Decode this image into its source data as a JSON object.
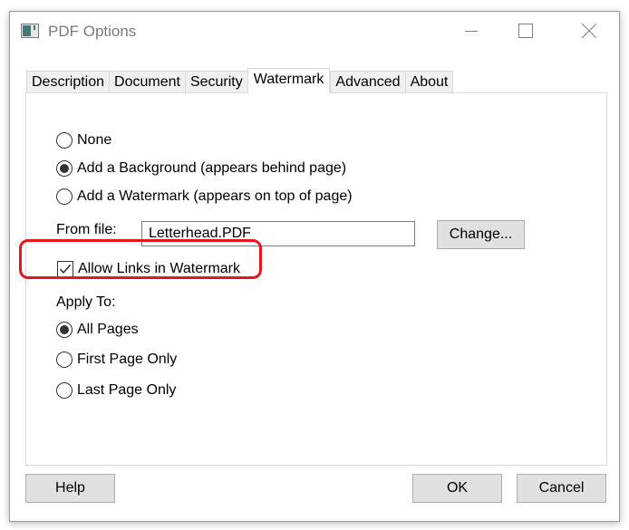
{
  "window": {
    "title": "PDF Options",
    "controls": {
      "minimize": "minimize",
      "maximize": "maximize",
      "close": "close"
    }
  },
  "tabs": [
    {
      "label": "Description",
      "active": false
    },
    {
      "label": "Document",
      "active": false
    },
    {
      "label": "Security",
      "active": false
    },
    {
      "label": "Watermark",
      "active": true
    },
    {
      "label": "Advanced",
      "active": false
    },
    {
      "label": "About",
      "active": false
    }
  ],
  "watermark": {
    "mode_options": [
      {
        "label": "None",
        "selected": false
      },
      {
        "label": "Add a Background (appears behind page)",
        "selected": true
      },
      {
        "label": "Add a Watermark (appears on top of page)",
        "selected": false
      }
    ],
    "from_file_label": "From file:",
    "from_file_value": "Letterhead.PDF",
    "change_button": "Change...",
    "allow_links_label": "Allow Links in Watermark",
    "allow_links_checked": true,
    "highlight_color": "#e8141e",
    "apply_to_label": "Apply To:",
    "apply_to_options": [
      {
        "label": "All Pages",
        "selected": true
      },
      {
        "label": "First Page Only",
        "selected": false
      },
      {
        "label": "Last Page Only",
        "selected": false
      }
    ]
  },
  "footer": {
    "help": "Help",
    "ok": "OK",
    "cancel": "Cancel"
  }
}
